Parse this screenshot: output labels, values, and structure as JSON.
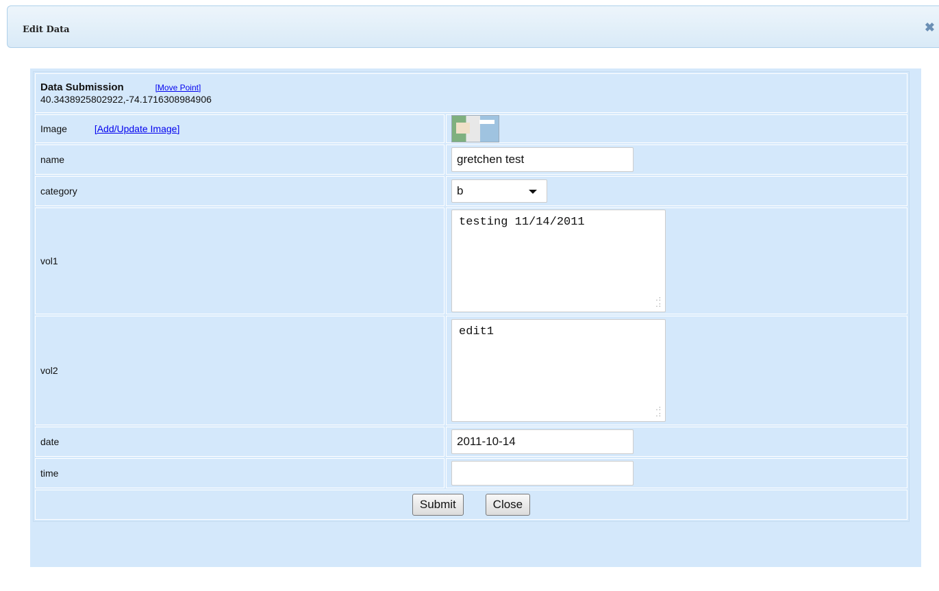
{
  "dialog": {
    "title": "Edit Data",
    "close_icon": "close-icon"
  },
  "form": {
    "header": {
      "title": "Data Submission",
      "move_point_label": "[Move Point]",
      "coordinates": "40.3438925802922,-74.1716308984906"
    },
    "image": {
      "label": "Image",
      "add_update_label": "[Add/Update Image]"
    },
    "name": {
      "label": "name",
      "value": "gretchen test"
    },
    "category": {
      "label": "category",
      "value": "b"
    },
    "vol1": {
      "label": "vol1",
      "value": "testing 11/14/2011"
    },
    "vol2": {
      "label": "vol2",
      "value": "edit1"
    },
    "date": {
      "label": "date",
      "value": "2011-10-14"
    },
    "time": {
      "label": "time",
      "value": ""
    }
  },
  "buttons": {
    "submit_label": "Submit",
    "close_label": "Close"
  }
}
